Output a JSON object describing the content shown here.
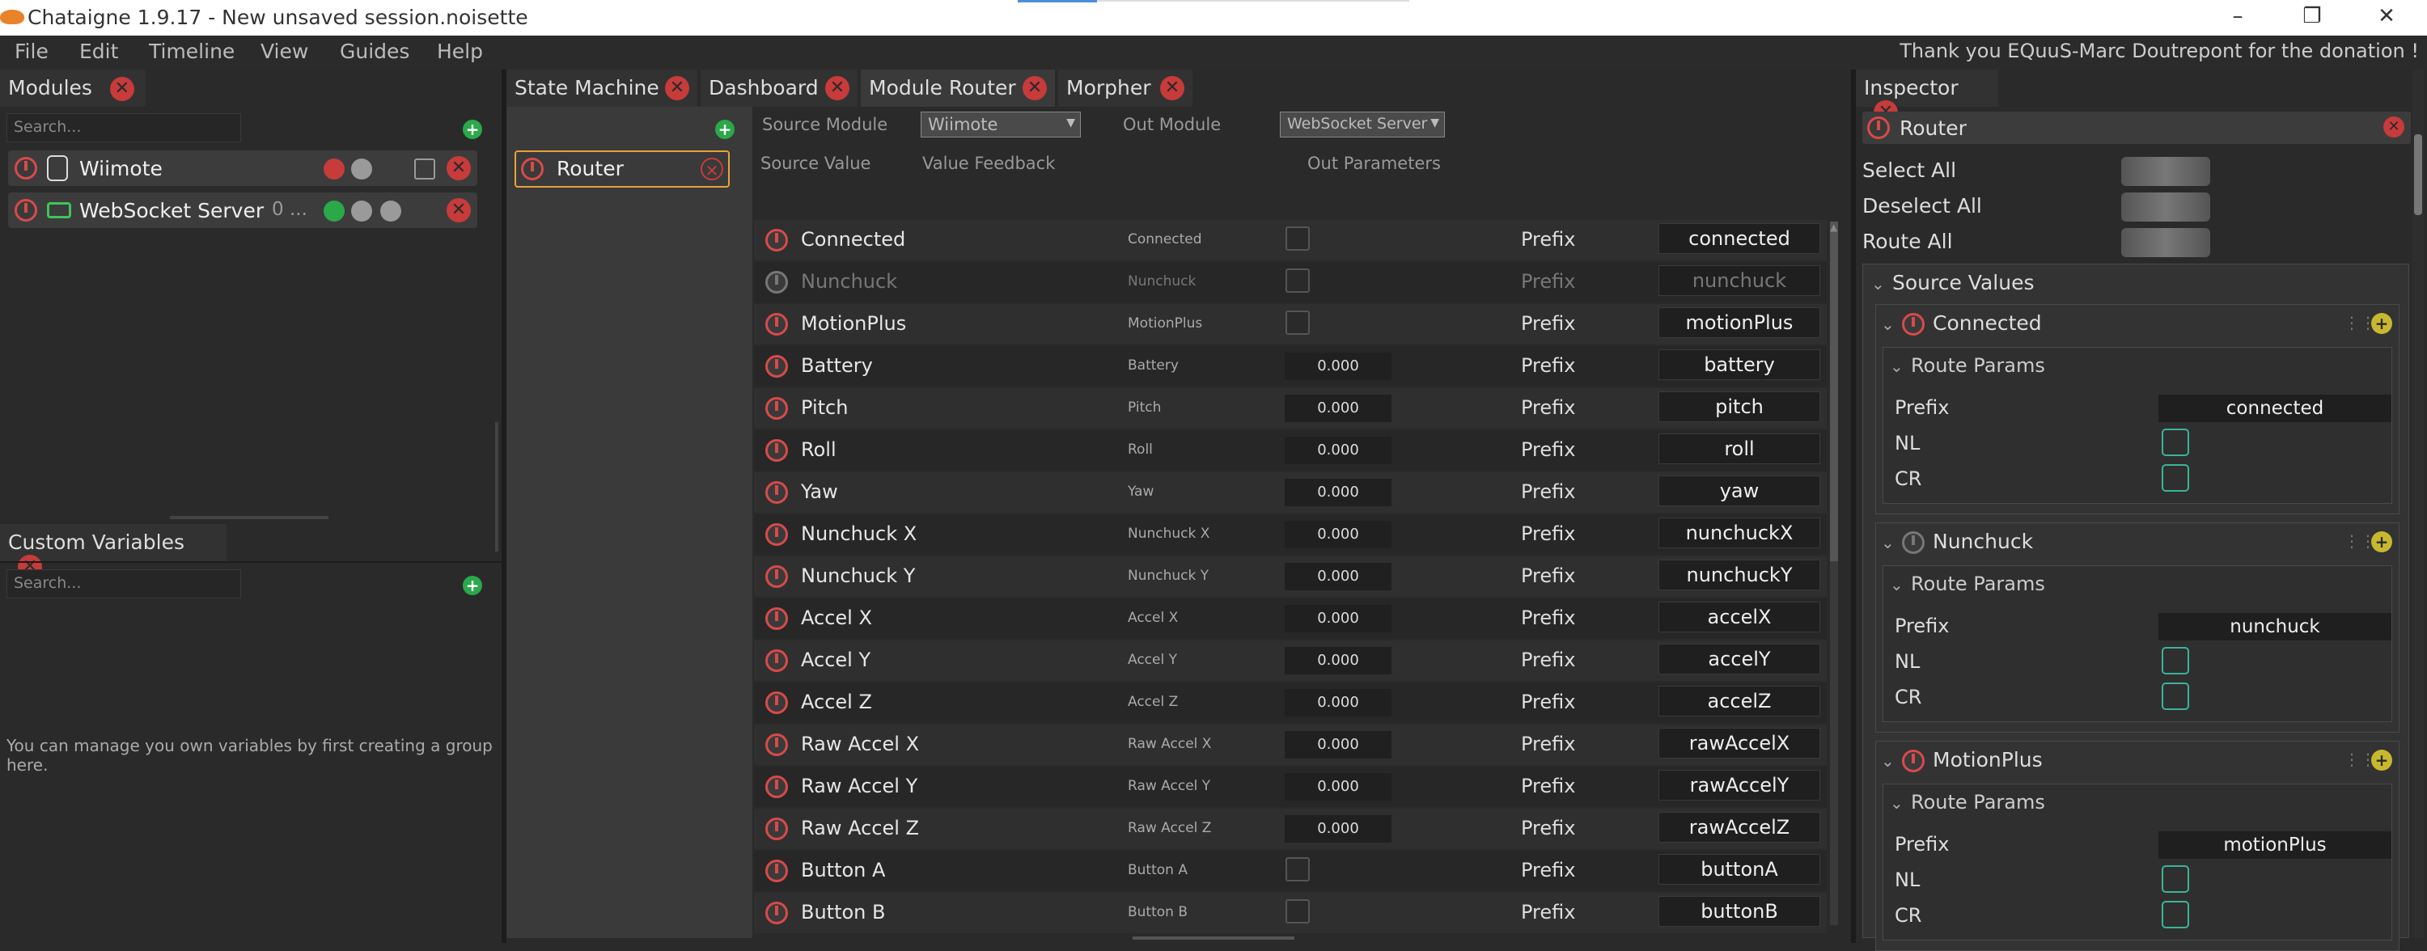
{
  "window": {
    "title": "Chataigne 1.9.17 - New unsaved session.noisette"
  },
  "menu": {
    "items": [
      "File",
      "Edit",
      "Timeline",
      "View",
      "Guides",
      "Help"
    ],
    "thanks": "Thank you EQuuS-Marc Doutrepont for the donation !"
  },
  "modules": {
    "tab": "Modules",
    "search_placeholder": "Search...",
    "items": [
      {
        "name": "Wiimote",
        "status": ""
      },
      {
        "name": "WebSocket Server",
        "status": "0 ..."
      }
    ]
  },
  "custom_variables": {
    "tab": "Custom Variables",
    "search_placeholder": "Search...",
    "empty_text": "You can manage you own variables by first creating a group here."
  },
  "center_tabs": [
    "State Machine",
    "Dashboard",
    "Module Router",
    "Morpher"
  ],
  "router_list": {
    "items": [
      "Router"
    ]
  },
  "router": {
    "source_module_label": "Source Module",
    "source_module_value": "Wiimote",
    "out_module_label": "Out Module",
    "out_module_value": "WebSocket Server",
    "col_source_value": "Source Value",
    "col_value_feedback": "Value Feedback",
    "col_out_parameters": "Out Parameters",
    "rows": [
      {
        "name": "Connected",
        "feedback": "Connected",
        "type": "bool",
        "value": "",
        "param": "Prefix",
        "prefix": "connected",
        "enabled": true
      },
      {
        "name": "Nunchuck",
        "feedback": "Nunchuck",
        "type": "bool",
        "value": "",
        "param": "Prefix",
        "prefix": "nunchuck",
        "enabled": false
      },
      {
        "name": "MotionPlus",
        "feedback": "MotionPlus",
        "type": "bool",
        "value": "",
        "param": "Prefix",
        "prefix": "motionPlus",
        "enabled": true
      },
      {
        "name": "Battery",
        "feedback": "Battery",
        "type": "float",
        "value": "0.000",
        "param": "Prefix",
        "prefix": "battery",
        "enabled": true
      },
      {
        "name": "Pitch",
        "feedback": "Pitch",
        "type": "float",
        "value": "0.000",
        "param": "Prefix",
        "prefix": "pitch",
        "enabled": true
      },
      {
        "name": "Roll",
        "feedback": "Roll",
        "type": "float",
        "value": "0.000",
        "param": "Prefix",
        "prefix": "roll",
        "enabled": true
      },
      {
        "name": "Yaw",
        "feedback": "Yaw",
        "type": "float",
        "value": "0.000",
        "param": "Prefix",
        "prefix": "yaw",
        "enabled": true
      },
      {
        "name": "Nunchuck X",
        "feedback": "Nunchuck X",
        "type": "float",
        "value": "0.000",
        "param": "Prefix",
        "prefix": "nunchuckX",
        "enabled": true
      },
      {
        "name": "Nunchuck Y",
        "feedback": "Nunchuck Y",
        "type": "float",
        "value": "0.000",
        "param": "Prefix",
        "prefix": "nunchuckY",
        "enabled": true
      },
      {
        "name": "Accel X",
        "feedback": "Accel X",
        "type": "float",
        "value": "0.000",
        "param": "Prefix",
        "prefix": "accelX",
        "enabled": true
      },
      {
        "name": "Accel Y",
        "feedback": "Accel Y",
        "type": "float",
        "value": "0.000",
        "param": "Prefix",
        "prefix": "accelY",
        "enabled": true
      },
      {
        "name": "Accel Z",
        "feedback": "Accel Z",
        "type": "float",
        "value": "0.000",
        "param": "Prefix",
        "prefix": "accelZ",
        "enabled": true
      },
      {
        "name": "Raw Accel X",
        "feedback": "Raw Accel X",
        "type": "float",
        "value": "0.000",
        "param": "Prefix",
        "prefix": "rawAccelX",
        "enabled": true
      },
      {
        "name": "Raw Accel Y",
        "feedback": "Raw Accel Y",
        "type": "float",
        "value": "0.000",
        "param": "Prefix",
        "prefix": "rawAccelY",
        "enabled": true
      },
      {
        "name": "Raw Accel Z",
        "feedback": "Raw Accel Z",
        "type": "float",
        "value": "0.000",
        "param": "Prefix",
        "prefix": "rawAccelZ",
        "enabled": true
      },
      {
        "name": "Button A",
        "feedback": "Button A",
        "type": "bool",
        "value": "",
        "param": "Prefix",
        "prefix": "buttonA",
        "enabled": true
      },
      {
        "name": "Button B",
        "feedback": "Button B",
        "type": "bool",
        "value": "",
        "param": "Prefix",
        "prefix": "buttonB",
        "enabled": true
      }
    ]
  },
  "inspector": {
    "tab": "Inspector",
    "title": "Router",
    "select_all": "Select All",
    "deselect_all": "Deselect All",
    "route_all": "Route All",
    "source_values": "Source Values",
    "route_params": "Route Params",
    "groups": [
      {
        "name": "Connected",
        "prefix_label": "Prefix",
        "prefix": "connected",
        "nl": "NL",
        "cr": "CR",
        "enabled": true
      },
      {
        "name": "Nunchuck",
        "prefix_label": "Prefix",
        "prefix": "nunchuck",
        "nl": "NL",
        "cr": "CR",
        "enabled": false
      },
      {
        "name": "MotionPlus",
        "prefix_label": "Prefix",
        "prefix": "motionPlus",
        "nl": "NL",
        "cr": "CR",
        "enabled": true
      }
    ]
  },
  "colors": {
    "accent_selection": "#e8a23a",
    "power_red": "#d84a4a",
    "add_green": "#2aa84a",
    "checkbox_teal": "#3bb39a",
    "close_red": "#c73b3b"
  }
}
